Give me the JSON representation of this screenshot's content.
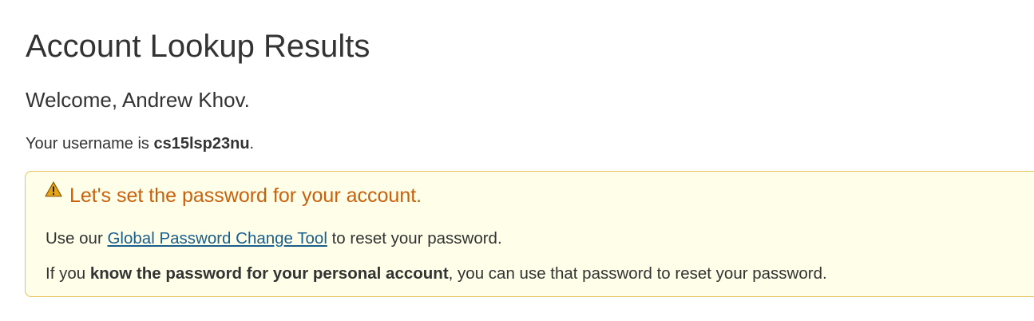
{
  "page": {
    "title": "Account Lookup Results",
    "welcome": "Welcome, Andrew Khov.",
    "username_prefix": "Your username is ",
    "username": "cs15lsp23nu",
    "username_suffix": "."
  },
  "alert": {
    "icon": "warning-icon",
    "heading": "Let's set the password for your account.",
    "line1_prefix": "Use our ",
    "line1_link": "Global Password Change Tool",
    "line1_suffix": " to reset your password.",
    "line2_prefix": "If you ",
    "line2_bold": "know the password for your personal account",
    "line2_suffix": ", you can use that password to reset your password."
  },
  "colors": {
    "alert_background": "#fefee9",
    "alert_border": "#e6c35c",
    "alert_heading": "#c9600c",
    "link": "#1a5e8c"
  }
}
